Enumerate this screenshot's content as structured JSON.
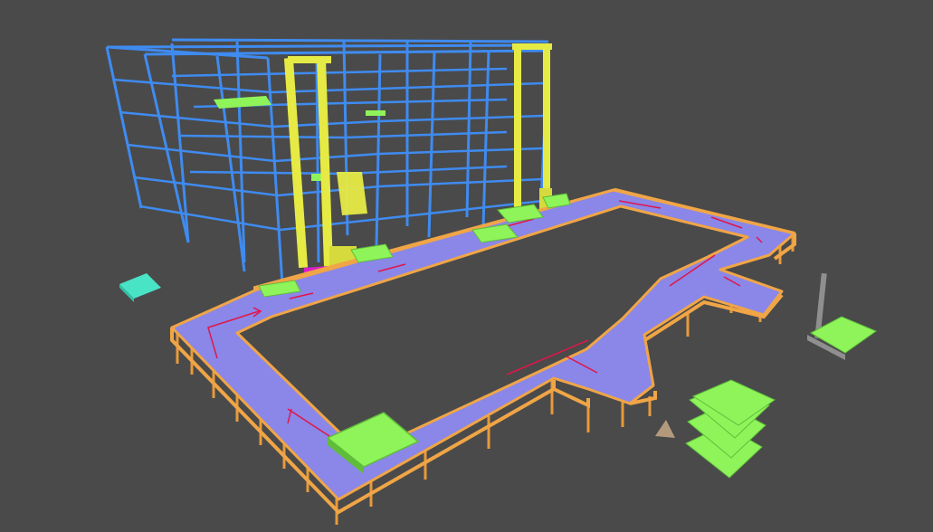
{
  "viewport": {
    "background": "#4a4a4a"
  },
  "colors": {
    "rack": "#3f8bf0",
    "stacker_crane": "#e6ea44",
    "stacker_crane_dark": "#b9bd2c",
    "conveyor_top": "#8a87e8",
    "conveyor_frame": "#f0a546",
    "conveyor_leg": "#e89a3a",
    "pallet": "#8ff45a",
    "pallet_edge": "#5fbd3a",
    "flow_arrow": "#e0164a",
    "cyan_pallet": "#49e3c6",
    "magenta_item": "#d81ec8",
    "robot_arm": "#8f8f8f",
    "cone_marker": "#b49a7c"
  },
  "scene": {
    "objects": [
      {
        "name": "storage-rack",
        "kind": "rack"
      },
      {
        "name": "stacker-crane",
        "kind": "crane",
        "count": 2
      },
      {
        "name": "conveyor-loop",
        "kind": "conveyor"
      },
      {
        "name": "pallet",
        "kind": "pallet"
      },
      {
        "name": "pallet-stack",
        "kind": "pallet",
        "count": 4
      },
      {
        "name": "cyan-pallet",
        "kind": "pallet"
      },
      {
        "name": "robot-arm",
        "kind": "robot"
      },
      {
        "name": "cone-marker",
        "kind": "marker"
      }
    ]
  }
}
